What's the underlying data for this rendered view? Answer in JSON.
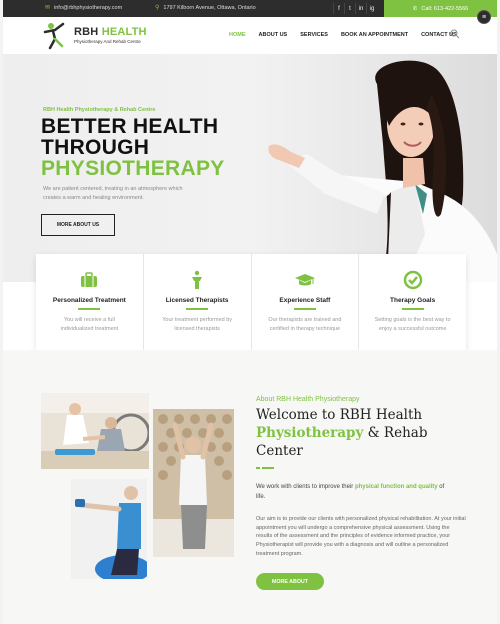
{
  "topbar": {
    "email": "info@rbhphysiotherapy.com",
    "address": "1797 Kilborn Avenue, Ottawa, Ontario",
    "social": [
      "f",
      "t",
      "in",
      "ig"
    ],
    "call": "Call: 613-422-5566"
  },
  "logo": {
    "brand": "RBH",
    "brand_green": "HEALTH",
    "subtitle": "Physiotherapy And Rehab Centre"
  },
  "nav": {
    "items": [
      "HOME",
      "ABOUT US",
      "SERVICES",
      "BOOK AN APPOINTMENT",
      "CONTACT US"
    ],
    "active_index": 0
  },
  "hero": {
    "subtitle": "RBH Health Physiotherapy & Rehab Centre",
    "line1": "BETTER HEALTH",
    "line2": "THROUGH",
    "line3": "PHYSIOTHERAPY",
    "text": "We are patient centered, treating in an atmosphere which creates a warm and healing environment.",
    "button": "MORE ABOUT US"
  },
  "features": [
    {
      "title": "Personalized Treatment",
      "text": "You will receive a full individualized treatment",
      "icon": "briefcase-icon"
    },
    {
      "title": "Licensed Therapists",
      "text": "Your treatment performed by licensed therapists",
      "icon": "person-icon"
    },
    {
      "title": "Experience Staff",
      "text": "Our therapists are trained and certified in therapy technique",
      "icon": "graduation-cap-icon"
    },
    {
      "title": "Therapy Goals",
      "text": "Setting goals is the best way to enjoy a successful outcome",
      "icon": "check-circle-icon"
    }
  ],
  "about": {
    "subtitle": "About RBH Health Physiotherapy",
    "heading_1": "Welcome to RBH Health",
    "heading_green": "Physiotherapy",
    "heading_2": "& Rehab",
    "heading_3": "Center",
    "intro_1": "We work with clients to improve their",
    "intro_green": "physical function and quality",
    "intro_2": "of life.",
    "body": "Our aim is to provide our clients with personalized physical rehabilitation. At your initial appointment you will undergo a comprehensive physical assessment. Using the results of the assessment and the principles of evidence informed practice, your Physiotherapist will provide you with a diagnosis and will outline a personalized treatment program.",
    "button": "MORE ABOUT"
  },
  "colors": {
    "accent": "#7fc241",
    "dark": "#2d2d2d"
  }
}
